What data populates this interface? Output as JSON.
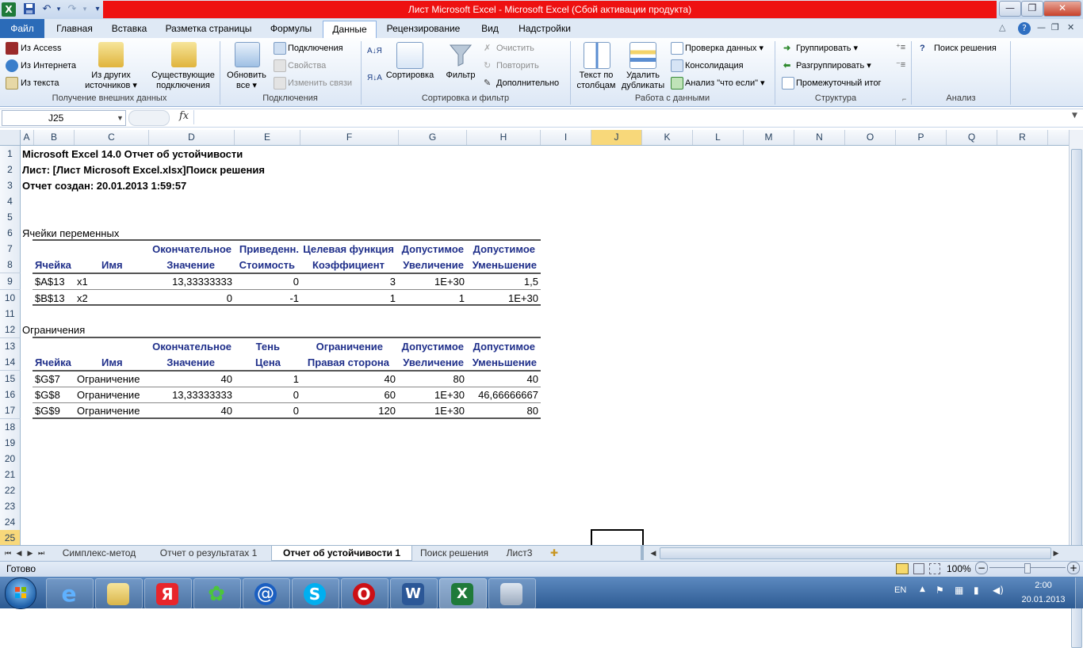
{
  "window": {
    "title": "Лист Microsoft Excel  -  Microsoft Excel (Сбой активации продукта)",
    "app_icon_letter": "X",
    "qat": {
      "save": "save-icon",
      "undo": "↶",
      "redo": "↷",
      "customize": "▾"
    },
    "controls": {
      "minimize": "—",
      "maximize": "❐",
      "close": "✕"
    },
    "ribbon_controls": {
      "help": "?",
      "minimize": "—",
      "restore": "❐",
      "close": "✕",
      "collapse": "△"
    }
  },
  "tabs": [
    "Файл",
    "Главная",
    "Вставка",
    "Разметка страницы",
    "Формулы",
    "Данные",
    "Рецензирование",
    "Вид",
    "Надстройки"
  ],
  "ribbon": {
    "external": {
      "access": "Из Access",
      "web": "Из Интернета",
      "text": "Из текста",
      "other_line1": "Из других",
      "other_line2": "источников ▾",
      "existing_line1": "Существующие",
      "existing_line2": "подключения",
      "label": "Получение внешних данных"
    },
    "connections": {
      "refresh_line1": "Обновить",
      "refresh_line2": "все ▾",
      "connections": "Подключения",
      "properties": "Свойства",
      "edit_links": "Изменить связи",
      "label": "Подключения"
    },
    "sort": {
      "az": "А↓Я",
      "za": "Я↓А",
      "sort": "Сортировка",
      "filter": "Фильтр",
      "clear": "Очистить",
      "reapply": "Повторить",
      "advanced": "Дополнительно",
      "label": "Сортировка и фильтр"
    },
    "data_tools": {
      "text_to_cols_line1": "Текст по",
      "text_to_cols_line2": "столбцам",
      "remove_dup_line1": "Удалить",
      "remove_dup_line2": "дубликаты",
      "validation": "Проверка данных ▾",
      "consolidate": "Консолидация",
      "whatif": "Анализ \"что если\" ▾",
      "label": "Работа с данными"
    },
    "outline": {
      "group": "Группировать ▾",
      "ungroup": "Разгруппировать ▾",
      "subtotal": "Промежуточный итог",
      "label": "Структура",
      "launcher": "⌐"
    },
    "analysis": {
      "solver": "Поиск решения",
      "label": "Анализ"
    }
  },
  "formula_bar": {
    "name_box": "J25",
    "fx": "fx",
    "formula": ""
  },
  "columns": [
    "A",
    "B",
    "C",
    "D",
    "E",
    "F",
    "G",
    "H",
    "I",
    "J",
    "K",
    "L",
    "M",
    "N",
    "O",
    "P",
    "Q",
    "R"
  ],
  "rows": [
    "1",
    "2",
    "3",
    "4",
    "5",
    "6",
    "7",
    "8",
    "9",
    "10",
    "11",
    "12",
    "13",
    "14",
    "15",
    "16",
    "17",
    "18",
    "19",
    "20",
    "21",
    "22",
    "23",
    "24",
    "25"
  ],
  "report": {
    "line1": "Microsoft Excel 14.0 Отчет об устойчивости",
    "line2": "Лист: [Лист Microsoft Excel.xlsx]Поиск решения",
    "line3": "Отчет создан: 20.01.2013 1:59:57",
    "vars_title": "Ячейки переменных",
    "vars_head1": [
      "",
      "",
      "Окончательное",
      "Приведенн.",
      "Целевая функция",
      "Допустимое",
      "Допустимое"
    ],
    "vars_head2": [
      "Ячейка",
      "Имя",
      "Значение",
      "Стоимость",
      "Коэффициент",
      "Увеличение",
      "Уменьшение"
    ],
    "vars_rows": [
      [
        "$A$13",
        "x1",
        "13,33333333",
        "0",
        "3",
        "1E+30",
        "1,5"
      ],
      [
        "$B$13",
        "x2",
        "0",
        "-1",
        "1",
        "1",
        "1E+30"
      ]
    ],
    "cons_title": "Ограничения",
    "cons_head1": [
      "",
      "",
      "Окончательное",
      "Тень",
      "Ограничение",
      "Допустимое",
      "Допустимое"
    ],
    "cons_head2": [
      "Ячейка",
      "Имя",
      "Значение",
      "Цена",
      "Правая сторона",
      "Увеличение",
      "Уменьшение"
    ],
    "cons_rows": [
      [
        "$G$7",
        "Ограничение",
        "40",
        "1",
        "40",
        "80",
        "40"
      ],
      [
        "$G$8",
        "Ограничение",
        "13,33333333",
        "0",
        "60",
        "1E+30",
        "46,66666667"
      ],
      [
        "$G$9",
        "Ограничение",
        "40",
        "0",
        "120",
        "1E+30",
        "80"
      ]
    ]
  },
  "sheet_tabs": [
    "Симплекс-метод",
    "Отчет о результатах 1",
    "Отчет об устойчивости 1",
    "Поиск решения",
    "Лист3"
  ],
  "sheet_nav": [
    "⏮",
    "◀",
    "▶",
    "⏭"
  ],
  "status": {
    "ready": "Готово",
    "zoom": "100%",
    "minus": "−",
    "plus": "+"
  },
  "taskbar": {
    "lang": "EN",
    "time": "2:00",
    "date": "20.01.2013",
    "apps": [
      "ie-icon",
      "folder-icon",
      "yandex-icon",
      "icq-icon",
      "mail-icon",
      "skype-icon",
      "opera-icon",
      "word-icon",
      "excel-icon",
      "calculator-icon"
    ],
    "app_glyphs": [
      "e",
      "",
      "Я",
      "✿",
      "@",
      "S",
      "O",
      "W",
      "X",
      ""
    ]
  },
  "colors": {
    "accent": "#2b6bb8",
    "title_red": "#ee1111",
    "header_blue": "#1f2f8a"
  }
}
